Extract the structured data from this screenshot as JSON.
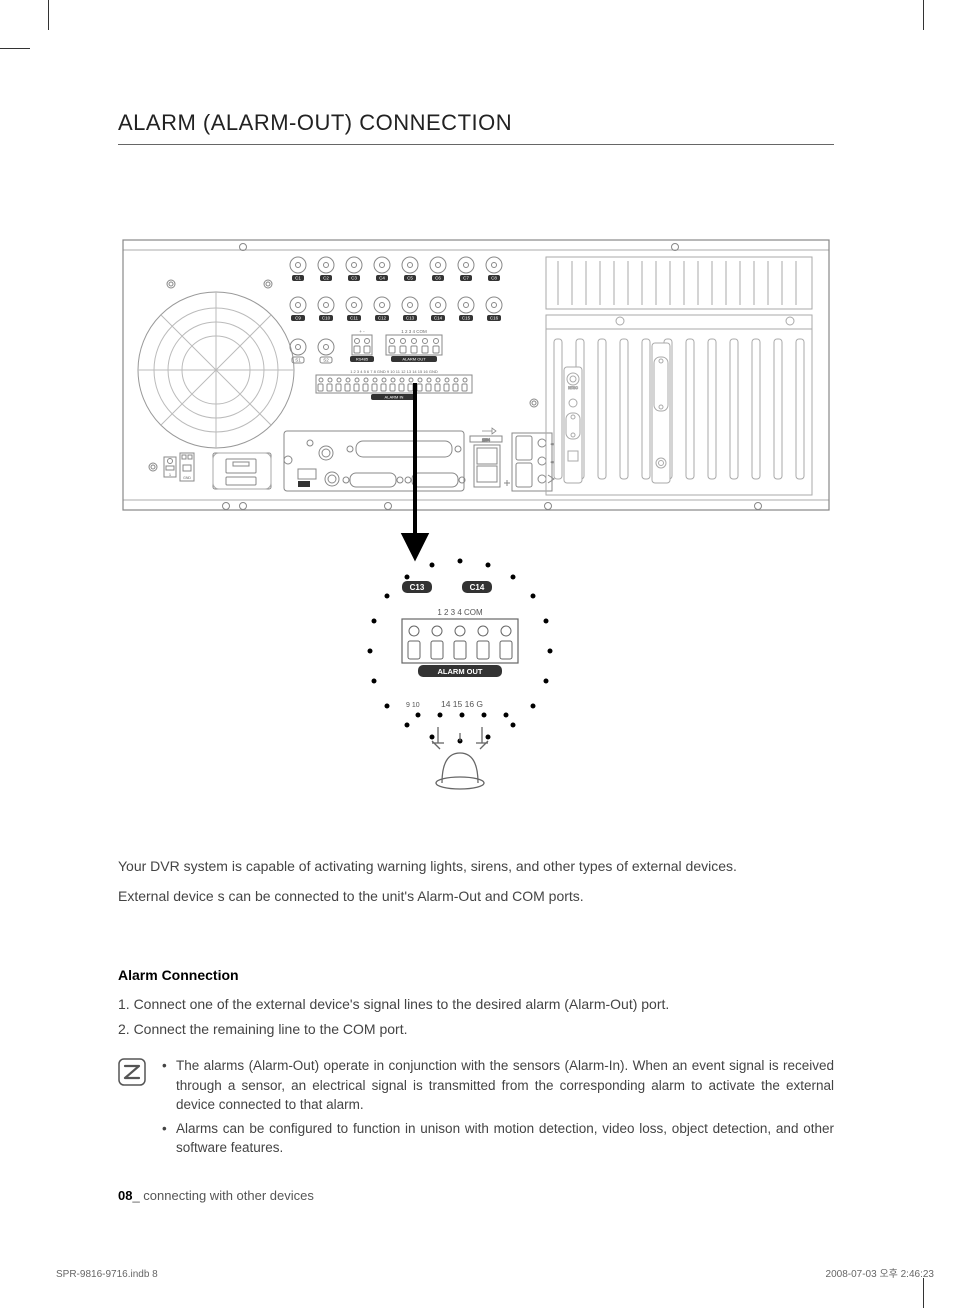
{
  "heading": "ALARM (ALARM-OUT) CONNECTION",
  "intro_line1": "Your DVR system is capable of activating warning lights, sirens, and other types of external devices.",
  "intro_line2": "External device s can be connected to the unit's Alarm-Out and COM ports.",
  "subheading": "Alarm Connection",
  "step1": "1. Connect one of the external device's signal lines to the desired alarm (Alarm-Out) port.",
  "step2": "2. Connect the remaining line to the COM port.",
  "note1": "The alarms (Alarm-Out) operate in conjunction with the sensors (Alarm-In). When an event signal is received through a sensor, an electrical signal is transmitted from the corresponding alarm to activate the external device connected to that alarm.",
  "note2": "Alarms can be configured to function in unison with motion detection, video loss, object detection, and other software features.",
  "footer_page": "08",
  "footer_text": "_ connecting with other devices",
  "print_left": "SPR-9816-9716.indb   8",
  "print_right": "2008-07-03   오후 2:46:23",
  "diagram": {
    "channels_top": [
      "C1",
      "C2",
      "C3",
      "C4",
      "C5",
      "C6",
      "C7",
      "C8"
    ],
    "channels_mid": [
      "C9",
      "C10",
      "C11",
      "C12",
      "C13",
      "C14",
      "C15",
      "C16"
    ],
    "rs_labels": [
      "S1",
      "S2"
    ],
    "rs485_label": "RS485",
    "alarm_out_small": "ALARM OUT",
    "alarm_in_strip": "1  2  3  4  5  6  7  8 GND 9 10 11 12 13 14 15 16 GND",
    "alarm_in_label": "ALARM IN",
    "sub_block_label1": "+ -",
    "sub_block_label2": "1  2  3  4  COM",
    "callout_c13": "C13",
    "callout_c14": "C14",
    "callout_header": "1    2    3    4    COM",
    "callout_label": "ALARM OUT",
    "callout_strip": "9 10  14  15  16 GND"
  }
}
